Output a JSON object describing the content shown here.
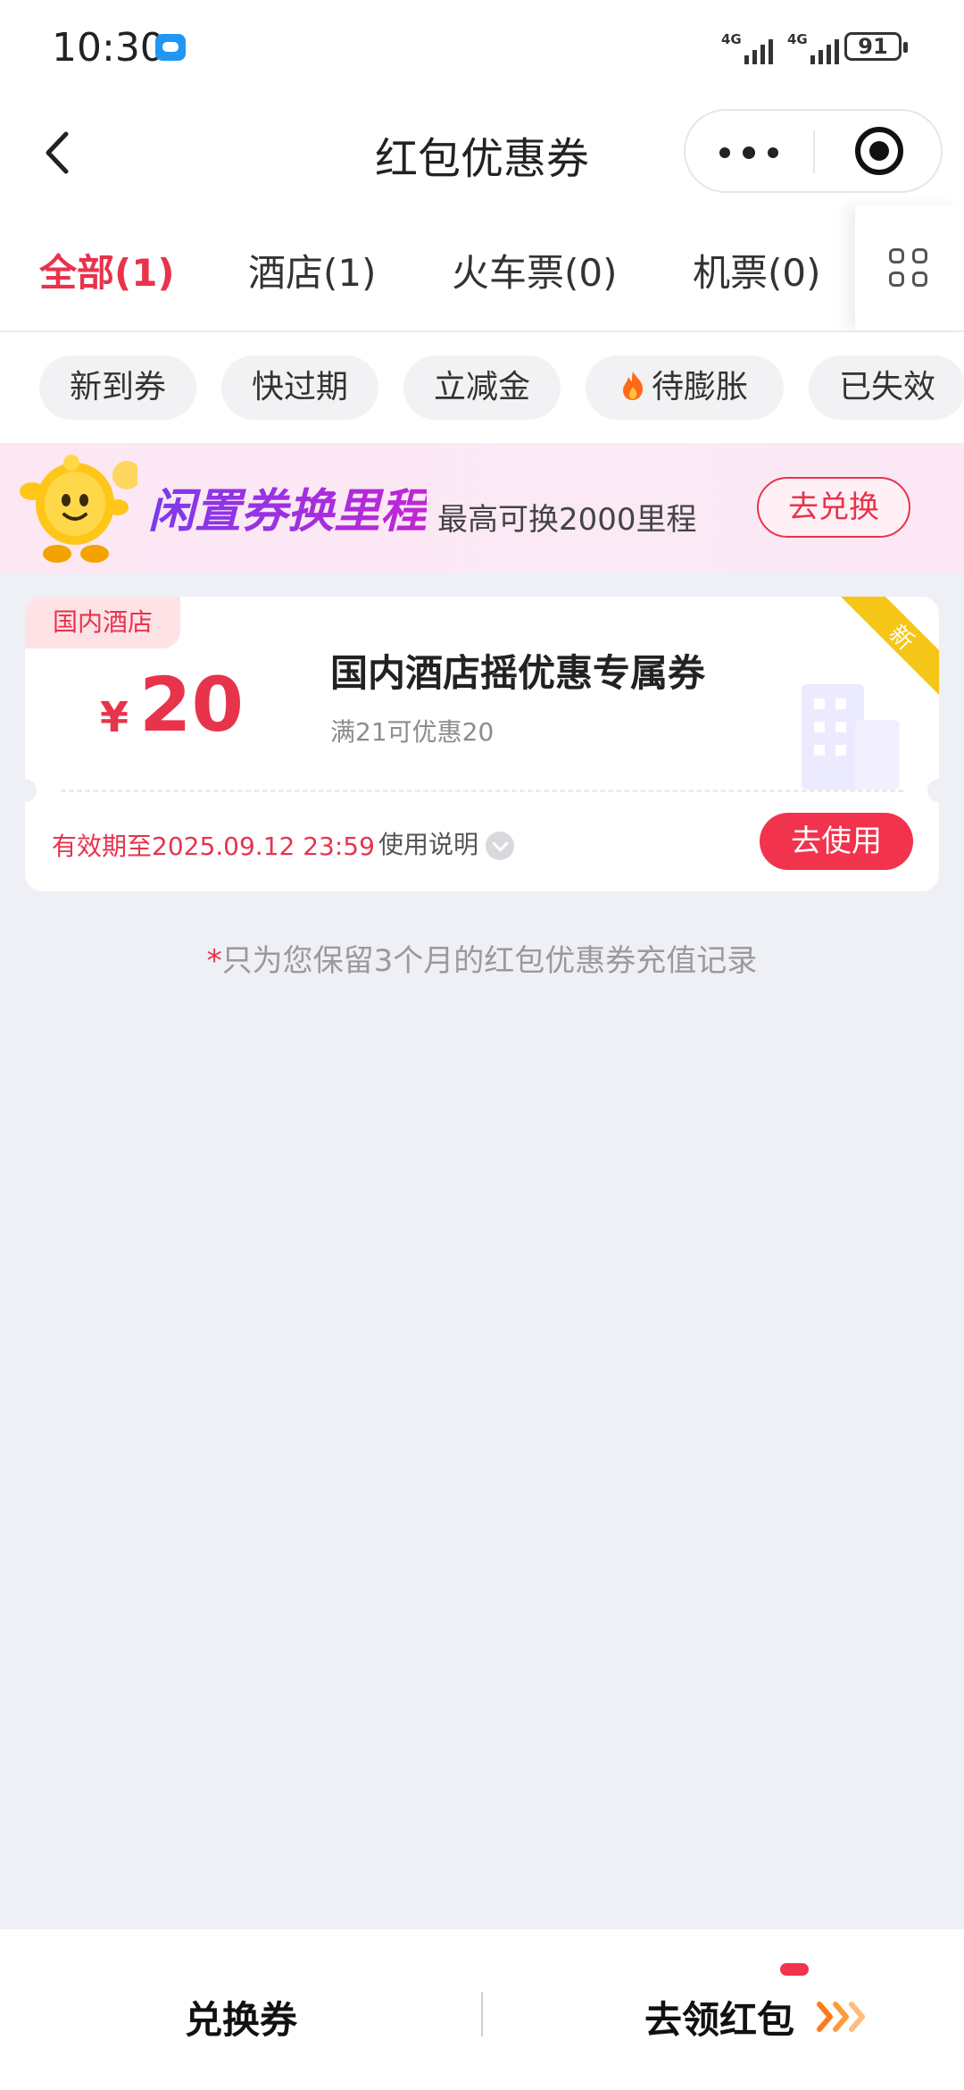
{
  "status_bar": {
    "time": "10:30",
    "network1": "4G",
    "network2": "4G",
    "battery": "91"
  },
  "nav": {
    "title": "红包优惠券"
  },
  "tabs": [
    {
      "label": "全部(1)",
      "active": true
    },
    {
      "label": "酒店(1)",
      "active": false
    },
    {
      "label": "火车票(0)",
      "active": false
    },
    {
      "label": "机票(0)",
      "active": false
    }
  ],
  "filters": [
    "新到券",
    "快过期",
    "立减金",
    "待膨胀",
    "已失效"
  ],
  "banner": {
    "title": "闲置券换里程",
    "subtitle": "最高可换2000里程",
    "button": "去兑换"
  },
  "coupon": {
    "tag": "国内酒店",
    "currency": "¥",
    "amount": "20",
    "title": "国内酒店摇优惠专属券",
    "condition": "满21可优惠20",
    "new_label": "新",
    "expiry": "有效期至2025.09.12 23:59",
    "usage_label": "使用说明",
    "use_button": "去使用"
  },
  "footnote": {
    "star": "*",
    "text": "只为您保留3个月的红包优惠券充值记录"
  },
  "bottom": {
    "left_label": "兑换券",
    "right_label": "去领红包"
  },
  "colors": {
    "accent": "#e8334c",
    "background": "#eef0f5",
    "banner_purple": "#7c3aed",
    "arrow_orange": "#ff7a1a"
  }
}
